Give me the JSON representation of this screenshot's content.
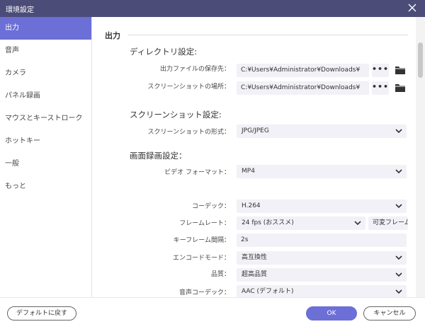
{
  "window": {
    "title": "環境設定"
  },
  "sidebar": {
    "items": [
      {
        "label": "出力"
      },
      {
        "label": "音声"
      },
      {
        "label": "カメラ"
      },
      {
        "label": "パネル録画"
      },
      {
        "label": "マウスとキーストローク"
      },
      {
        "label": "ホットキー"
      },
      {
        "label": "一般"
      },
      {
        "label": "もっと"
      }
    ],
    "active_index": 0
  },
  "main": {
    "section_title": "出力",
    "directory": {
      "heading": "ディレクトリ設定:",
      "output_label": "出力ファイルの保存先：",
      "output_value": "C:¥Users¥Administrator¥Downloads¥",
      "screenshot_label": "スクリーンショットの場所：",
      "screenshot_value": "C:¥Users¥Administrator¥Downloads¥",
      "dots": "•••"
    },
    "screenshot": {
      "heading": "スクリーンショット設定:",
      "format_label": "スクリーンショットの形式：",
      "format_value": "JPG/JPEG"
    },
    "recording": {
      "heading": "画面録画設定：",
      "video_format_label": "ビデオ フォーマット：",
      "video_format_value": "MP4",
      "codec_label": "コーデック：",
      "codec_value": "H.264",
      "framerate_label": "フレームレート：",
      "framerate_value": "24 fps (おススメ)",
      "variable_frame_value": "可変フレーム",
      "keyframe_label": "キーフレーム間隔：",
      "keyframe_value": "2s",
      "encode_label": "エンコードモード：",
      "encode_value": "高互換性",
      "quality_label": "品質：",
      "quality_value": "超高品質",
      "audio_codec_label": "音声コーデック：",
      "audio_codec_value": "AAC (デフォルト)"
    }
  },
  "footer": {
    "reset_label": "デフォルトに戻す",
    "ok_label": "OK",
    "cancel_label": "キャンセル"
  },
  "colors": {
    "titlebar": "#4b4c78",
    "accent": "#6b6fd6",
    "field_bg": "#f1f1f7"
  }
}
